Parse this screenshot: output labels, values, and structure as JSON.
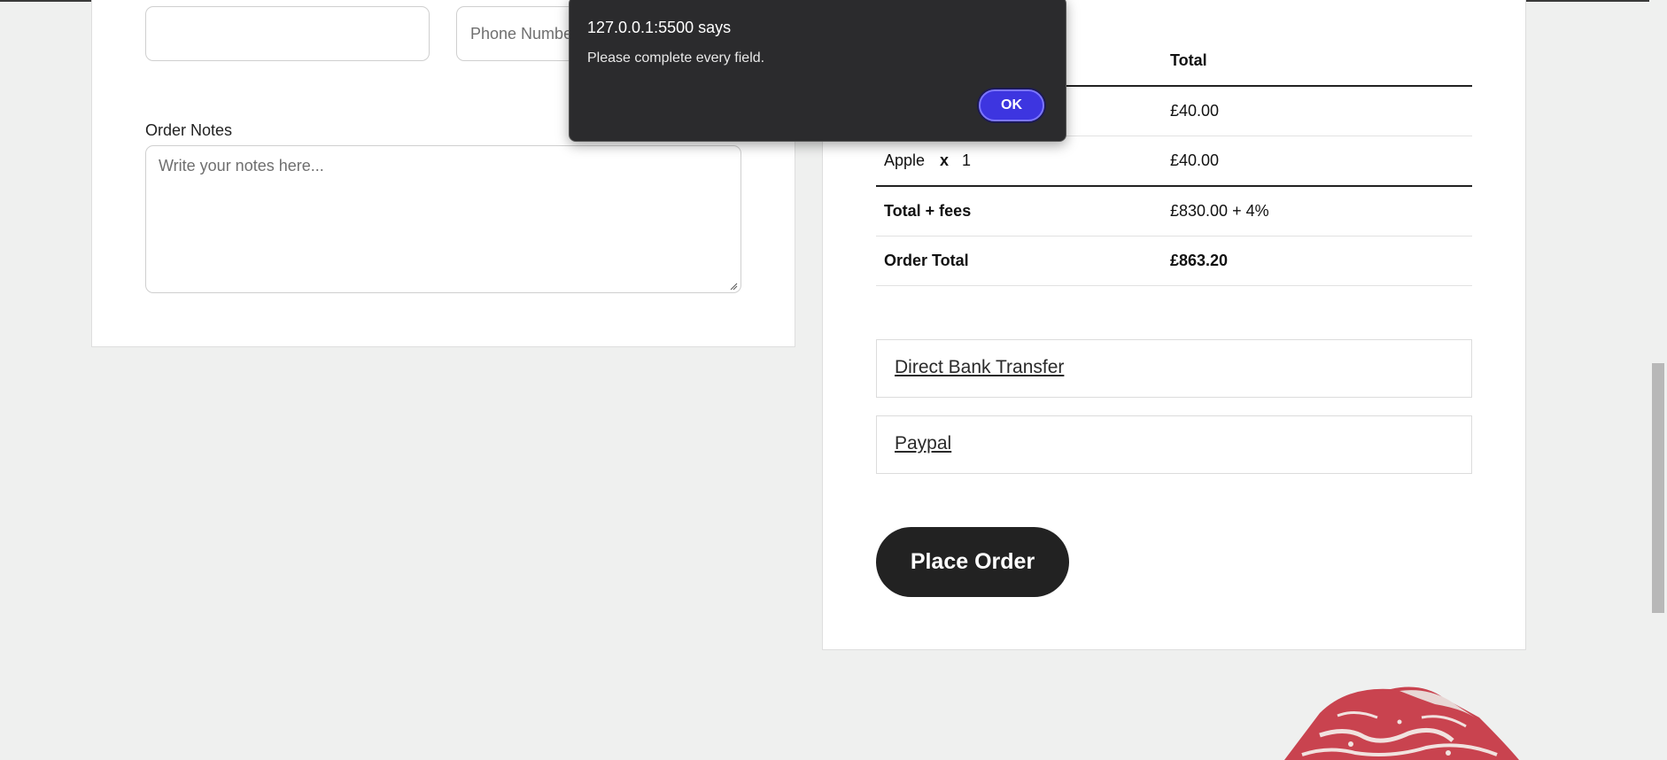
{
  "billing": {
    "phone_placeholder": "Phone Number",
    "order_notes_label": "Order Notes",
    "order_notes_placeholder": "Write your notes here..."
  },
  "order_summary": {
    "header_total": "Total",
    "rows": [
      {
        "product": "",
        "qty_sep": "",
        "qty": "",
        "total": "£40.00"
      },
      {
        "product": "Apple",
        "qty_sep": "x",
        "qty": "1",
        "total": "£40.00"
      }
    ],
    "total_fees_label": "Total + fees",
    "total_fees_value": "£830.00 + 4%",
    "order_total_label": "Order Total",
    "order_total_value": "£863.20"
  },
  "payment_methods": [
    "Direct Bank Transfer",
    "Paypal"
  ],
  "place_order_label": "Place Order",
  "dialog": {
    "title": "127.0.0.1:5500 says",
    "message": "Please complete every field.",
    "ok_label": "OK"
  }
}
